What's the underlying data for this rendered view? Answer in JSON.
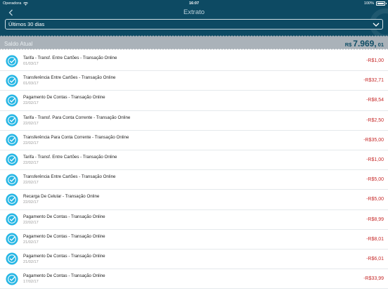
{
  "status_bar": {
    "carrier": "Operadora",
    "time": "16:07",
    "battery": "100%"
  },
  "nav": {
    "title": "Extrato",
    "back_icon": "chevron-left-icon"
  },
  "period": {
    "selected": "Últimos 30 dias",
    "icon": "chevron-down-icon"
  },
  "balance": {
    "label": "Saldo Atual",
    "currency": "R$",
    "integer": "7.969,",
    "cents": "01"
  },
  "colors": {
    "header": "#0d4a63",
    "balance_bar": "#aab2b9",
    "debit": "#c62828",
    "check_icon": "#26b6e4"
  },
  "transactions": [
    {
      "description": "Tarifa - Transf. Entre Cartões - Transação Online",
      "date": "01/03/17",
      "amount": "-R$1,00"
    },
    {
      "description": "Transferência Entre Cartões - Transação Online",
      "date": "01/03/17",
      "amount": "-R$32,71"
    },
    {
      "description": "Pagamento De Contas - Transação Online",
      "date": "22/02/17",
      "amount": "-R$8,54"
    },
    {
      "description": " Tarifa - Transf. Para Conta Corrente - Transação Online",
      "date": "22/02/17",
      "amount": "-R$2,50"
    },
    {
      "description": "Transferência Para Conta Corrente - Transação Online",
      "date": "22/02/17",
      "amount": "-R$35,00"
    },
    {
      "description": "Tarifa - Transf. Entre Cartões - Transação Online",
      "date": "22/02/17",
      "amount": "-R$1,00"
    },
    {
      "description": "Transferência Entre Cartões - Transação Online",
      "date": "22/02/17",
      "amount": "-R$5,00"
    },
    {
      "description": "Recarga De Celular - Transação Online",
      "date": "22/02/17",
      "amount": "-R$5,00"
    },
    {
      "description": "Pagamento De Contas - Transação Online",
      "date": "22/02/17",
      "amount": "-R$8,99"
    },
    {
      "description": "Pagamento De Contas - Transação Online",
      "date": "21/02/17",
      "amount": "-R$8,01"
    },
    {
      "description": "Pagamento De Contas - Transação Online",
      "date": "21/02/17",
      "amount": "-R$6,01"
    },
    {
      "description": "Pagamento De Contas - Transação Online",
      "date": "17/02/17",
      "amount": "-R$33,99"
    }
  ]
}
